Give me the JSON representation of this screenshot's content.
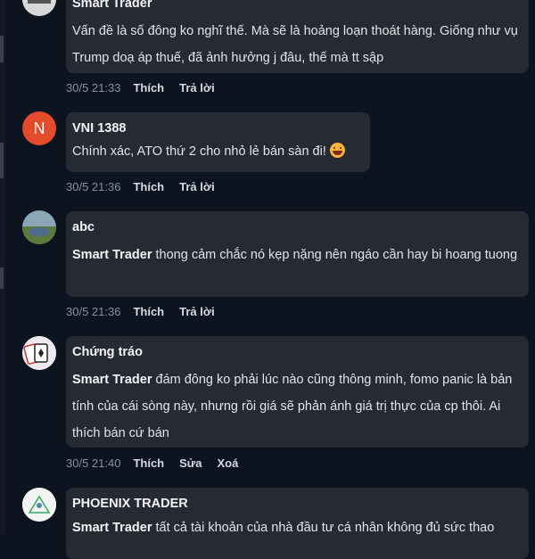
{
  "comments": [
    {
      "author": "Smart Trader",
      "text": "Vấn đề là số đông ko nghĩ thế. Mà sẽ là hoảng loạn thoát hàng. Giống như vụ Trump doạ áp thuế, đã ảnh hưởng j đâu, thế mà tt sập",
      "time": "30/5 21:33",
      "actions": [
        "Thích",
        "Trả lời"
      ]
    },
    {
      "author": "VNI 1388",
      "avatar_letter": "N",
      "avatar_color": "#e34b2a",
      "text": "Chính xác, ATO thứ 2 cho nhỏ lẻ bán sàn đi!",
      "time": "30/5 21:36",
      "actions": [
        "Thích",
        "Trả lời"
      ]
    },
    {
      "author": "abc",
      "mention": "Smart Trader",
      "text": "thong cảm chắc nó kẹp nặng nên ngáo cần hay bi hoang tuong",
      "time": "30/5 21:36",
      "actions": [
        "Thích",
        "Trả lời"
      ]
    },
    {
      "author": "Chứng tráo",
      "mention": "Smart Trader",
      "text": "đám đông ko phải lúc nào cũng thông minh, fomo panic là bản tính của cái sòng này, nhưng rồi giá sẽ phản ánh giá trị thực của cp thôi. Ai thích bán cứ bán",
      "time": "30/5 21:40",
      "actions": [
        "Thích",
        "Sửa",
        "Xoá"
      ]
    },
    {
      "author": "PHOENIX TRADER",
      "mention": "Smart Trader",
      "text": "tất cả tài khoản của nhà đầu tư cá nhân không đủ sức thao"
    }
  ],
  "colors": {
    "background": "#0e1320",
    "bubble": "#262a33",
    "meta": "#8a8f99"
  }
}
